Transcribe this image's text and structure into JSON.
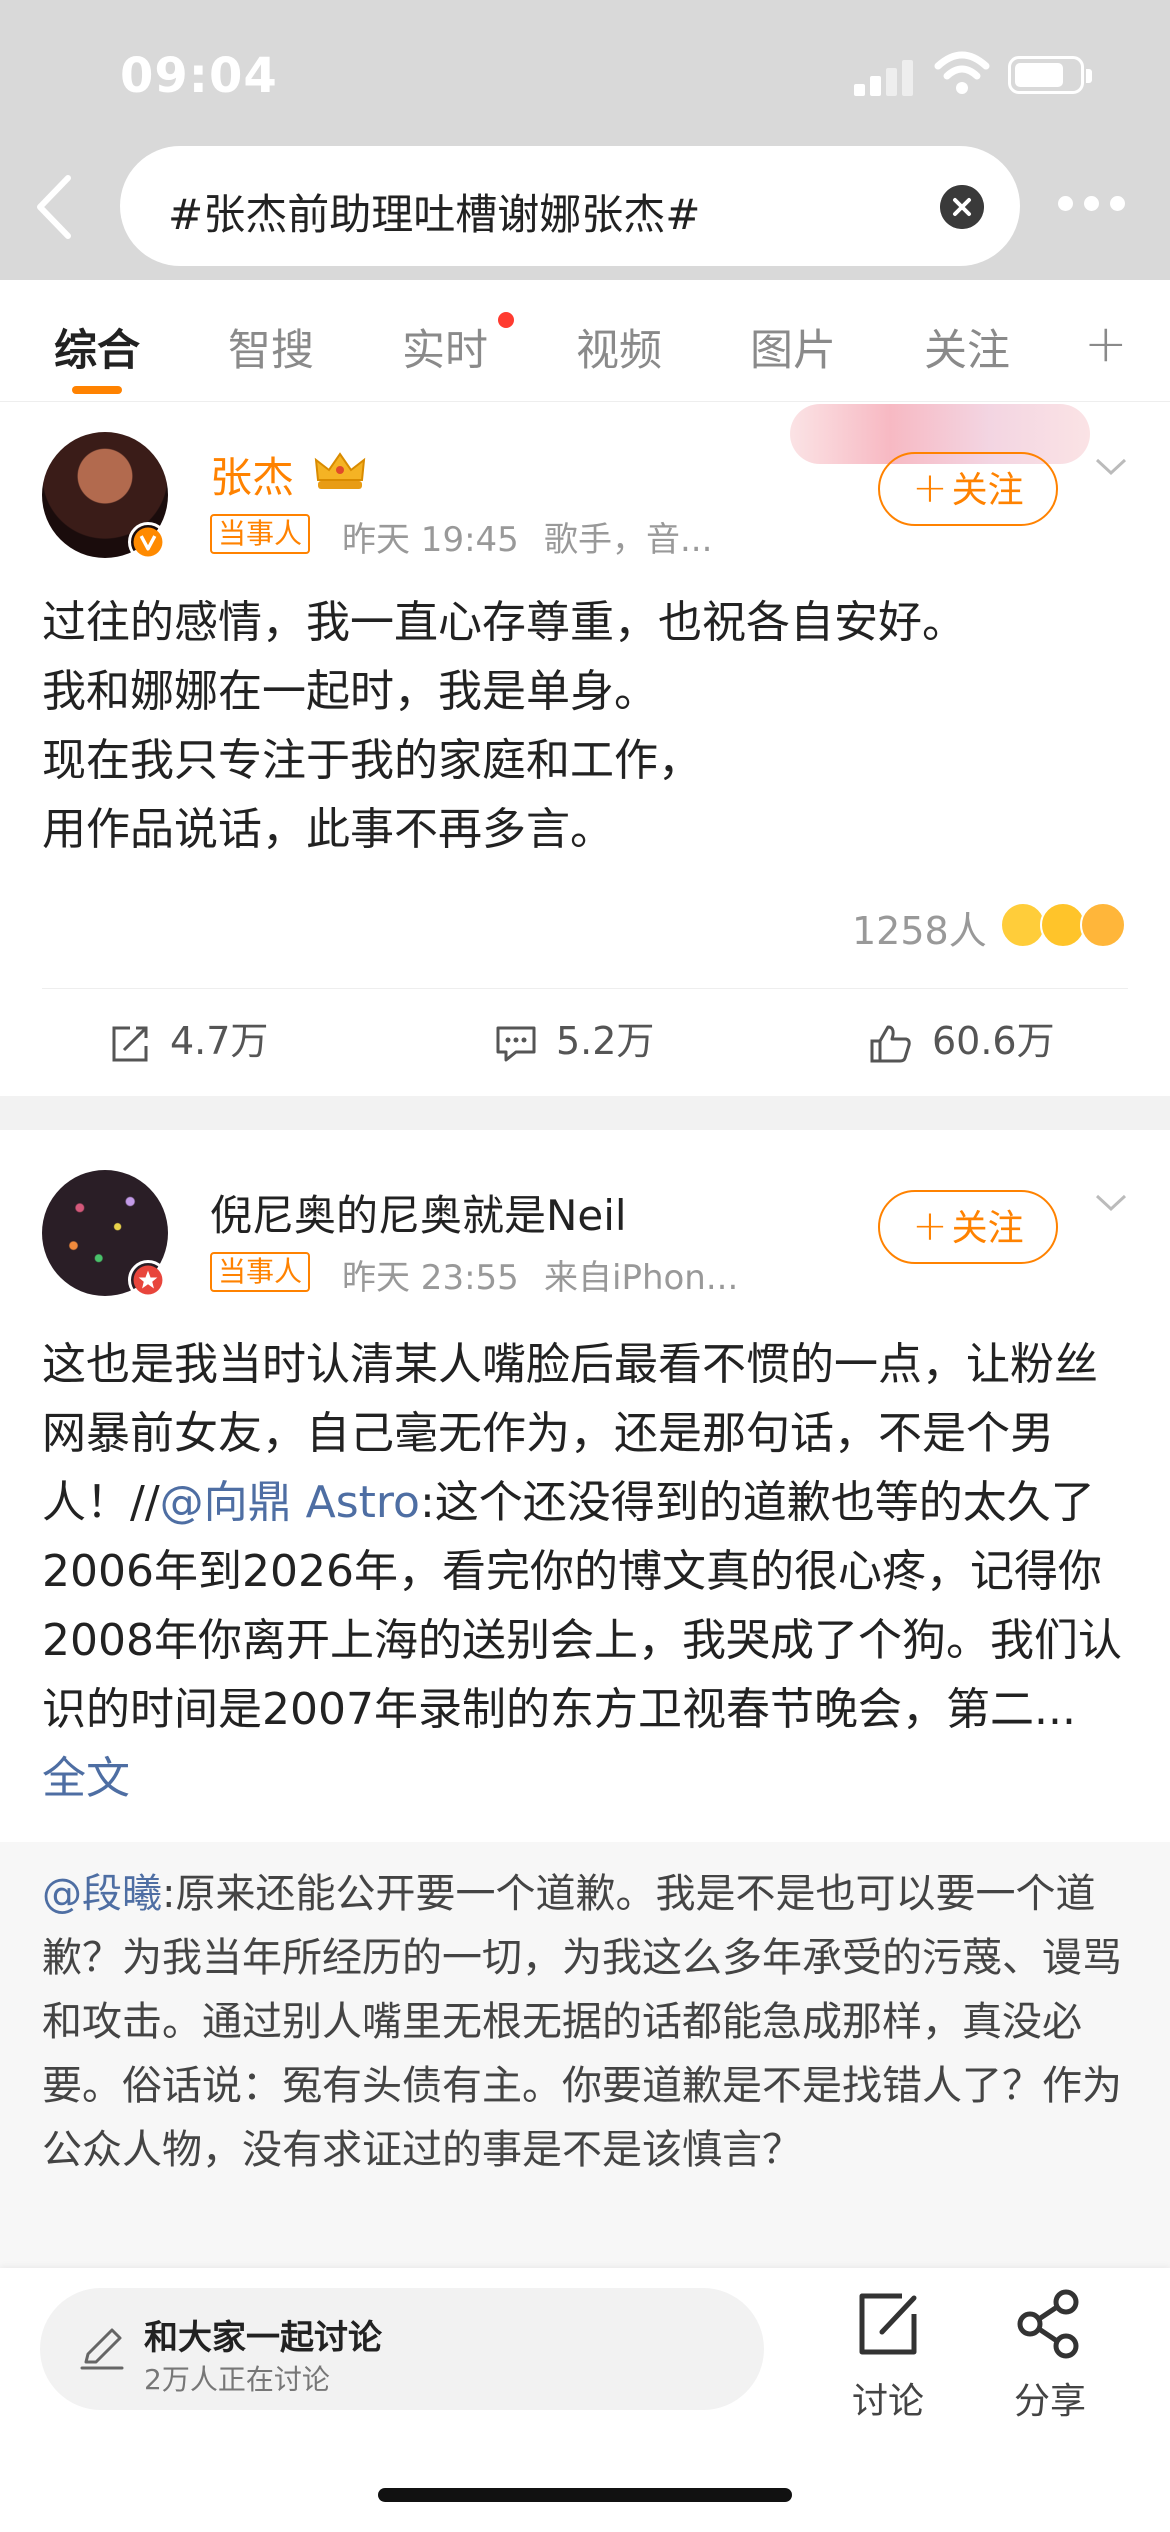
{
  "status_bar": {
    "time": "09:04"
  },
  "search": {
    "query": "#张杰前助理吐槽谢娜张杰#"
  },
  "tabs": [
    {
      "label": "综合",
      "active": true
    },
    {
      "label": "智搜"
    },
    {
      "label": "实时",
      "has_dot": true
    },
    {
      "label": "视频"
    },
    {
      "label": "图片"
    },
    {
      "label": "关注"
    }
  ],
  "tabs_add": "+",
  "post1": {
    "username": "张杰",
    "tag": "当事人",
    "time": "昨天 19:45",
    "meta": "歌手，音...",
    "follow": "关注",
    "lines": [
      "过往的感情，我一直心存尊重，也祝各自安好。",
      "我和娜娜在一起时，我是单身。",
      "现在我只专注于我的家庭和工作，",
      "用作品说话，此事不再多言。"
    ],
    "reactions_count": "1258人",
    "reposts": "4.7万",
    "comments": "5.2万",
    "likes": "60.6万"
  },
  "post2": {
    "username": "倪尼奥的尼奥就是Neil",
    "tag": "当事人",
    "time": "昨天 23:55",
    "meta": "来自iPhon...",
    "follow": "关注",
    "text_a": "这也是我当时认清某人嘴脸后最看不惯的一点，让粉丝网暴前女友，自己毫无作为，还是那句话，不是个男人！//",
    "mention": "@向鼎 Astro",
    "text_b": ":这个还没得到的道歉也等的太久了2006年到2026年，看完你的博文真的很心疼，记得你2008年你离开上海的送别会上，我哭成了个狗。我们认识的时间是2007年录制的东方卫视春节晚会，第二...",
    "full_text_link": "全文"
  },
  "quoted": {
    "mention": "@段曦",
    "text": ":原来还能公开要一个道歉。我是不是也可以要一个道歉？为我当年所经历的一切，为我这么多年承受的污蔑、谩骂和攻击。通过别人嘴里无根无据的话都能急成那样，真没必要。俗话说：冤有头债有主。你要道歉是不是找错人了？作为公众人物，没有求证过的事是不是该慎言？"
  },
  "bottom_bar": {
    "discuss_title": "和大家一起讨论",
    "discuss_sub": "2万人正在讨论",
    "discuss_btn": "讨论",
    "share_btn": "分享"
  },
  "colors": {
    "accent": "#ff8200",
    "link": "#4e6ea3",
    "dot": "#ff3b30"
  }
}
